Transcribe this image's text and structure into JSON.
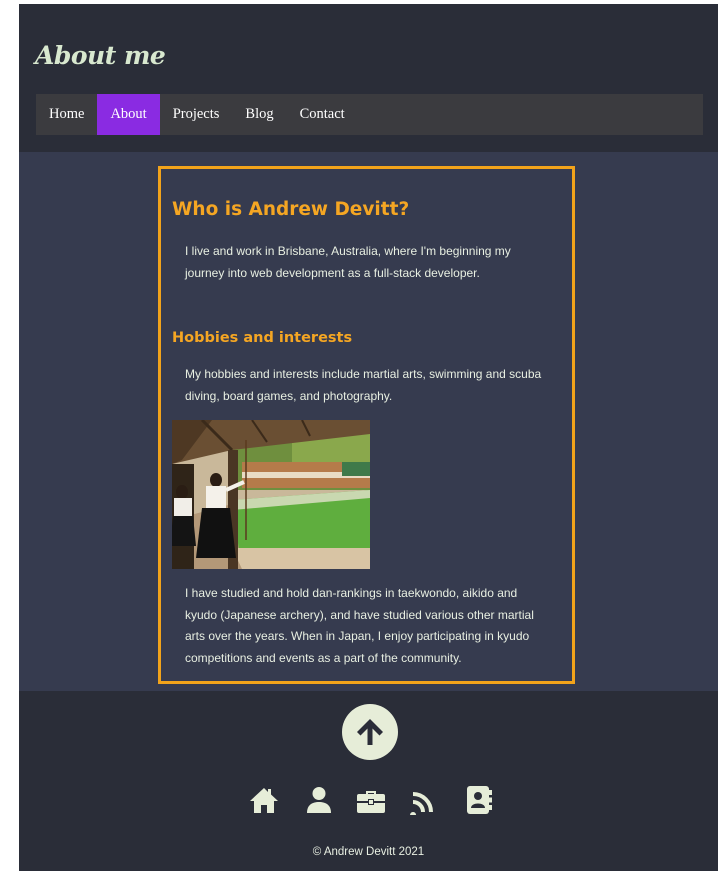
{
  "header": {
    "title": "About me"
  },
  "nav": {
    "items": [
      {
        "label": "Home",
        "active": false
      },
      {
        "label": "About",
        "active": true
      },
      {
        "label": "Projects",
        "active": false
      },
      {
        "label": "Blog",
        "active": false
      },
      {
        "label": "Contact",
        "active": false
      }
    ]
  },
  "main": {
    "heading": "Who is Andrew Devitt?",
    "intro": "I live and work in Brisbane, Australia, where I'm beginning my journey into web development as a full-stack developer.",
    "hobbies_heading": "Hobbies and interests",
    "hobbies": "My hobbies and interests include martial arts, swimming and scuba diving, board games, and photography.",
    "martial_arts": "I have studied and hold dan-rankings in taekwondo, aikido and kyudo (Japanese archery), and have studied various other martial arts over the years. When in Japan, I enjoy participating in kyudo competitions and events as a part of the community."
  },
  "footer": {
    "icons": [
      "home-icon",
      "user-icon",
      "briefcase-icon",
      "rss-icon",
      "address-book-icon"
    ],
    "copyright": "© Andrew Devitt 2021"
  },
  "colors": {
    "accent": "#f5a623",
    "nav_active": "#8a2be2",
    "icon": "#e6edd8"
  }
}
